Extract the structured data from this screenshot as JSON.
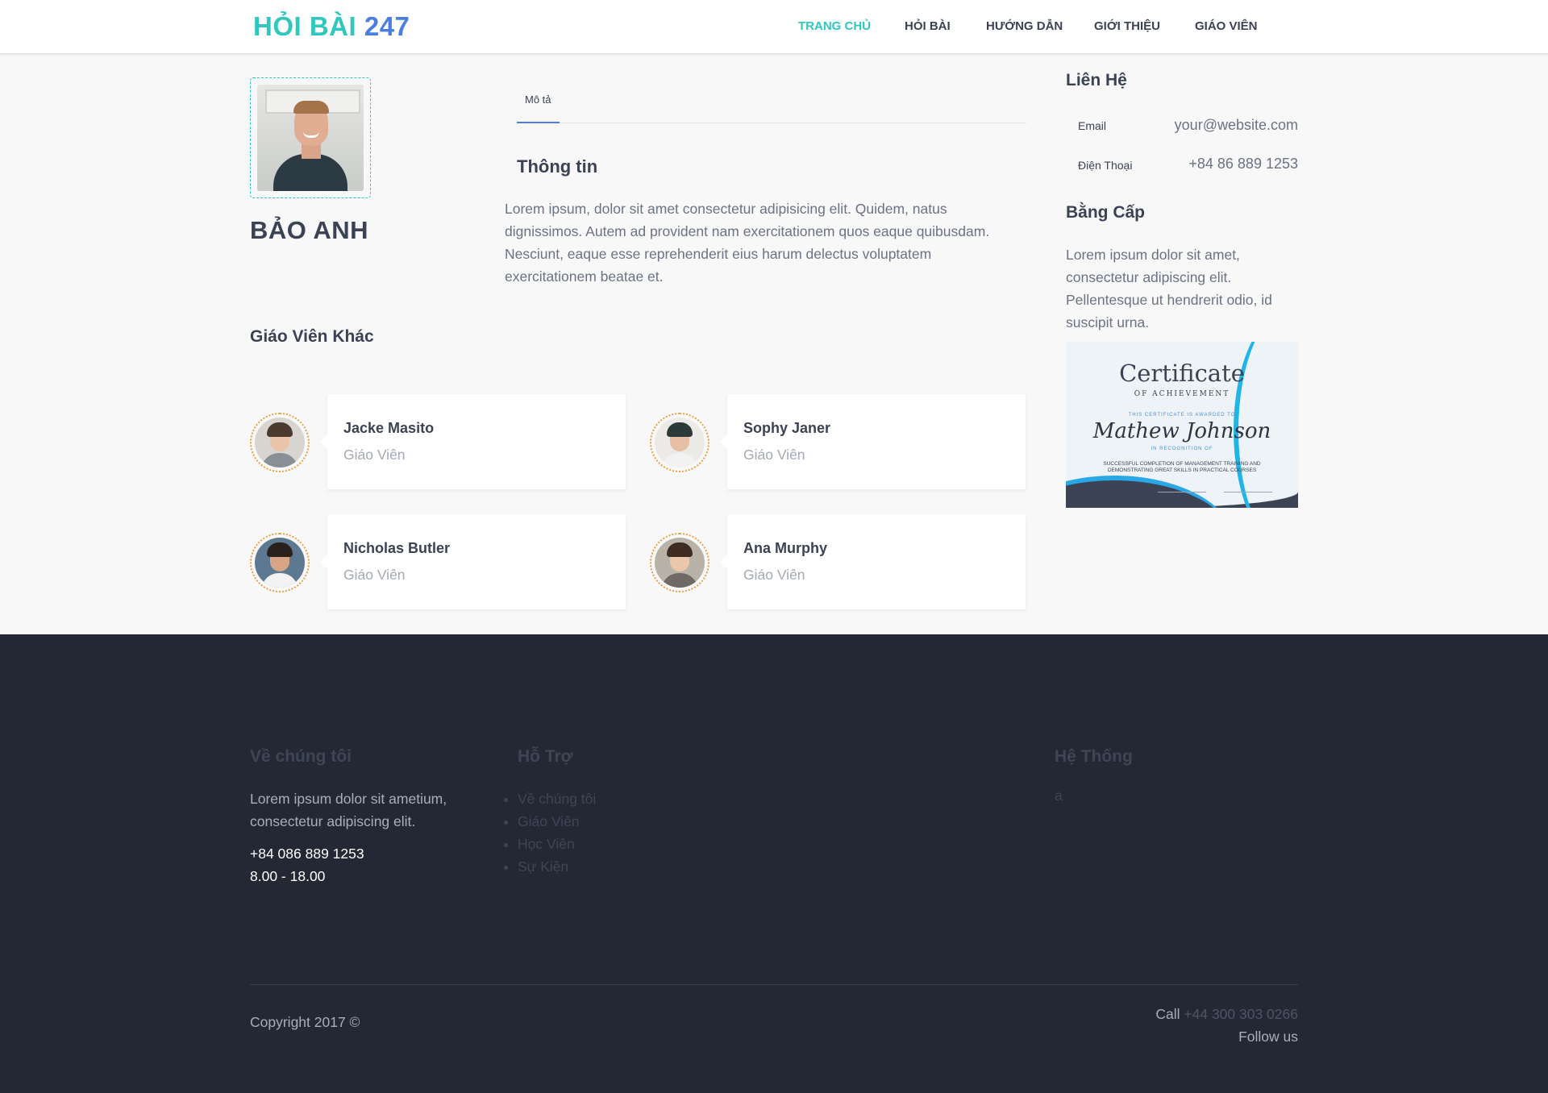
{
  "header": {
    "logo_part1": "HỎI BÀI",
    "logo_part2": "247",
    "nav": [
      {
        "label": "TRANG CHỦ",
        "active": true
      },
      {
        "label": "HỎI BÀI",
        "active": false
      },
      {
        "label": "HƯỚNG DẪN",
        "active": false
      },
      {
        "label": "GIỚI THIỆU",
        "active": false
      },
      {
        "label": "GIÁO VIÊN",
        "active": false
      }
    ]
  },
  "profile": {
    "name": "BẢO ANH"
  },
  "tabs": {
    "description": "Mô tả"
  },
  "info": {
    "title": "Thông tin",
    "text": "Lorem ipsum, dolor sit amet consectetur adipisicing elit. Quidem, natus dignissimos. Autem ad provident nam exercitationem quos eaque quibusdam. Nesciunt, eaque esse reprehenderit eius harum delectus voluptatem exercitationem beatae et."
  },
  "others": {
    "title": "Giáo Viên Khác",
    "teachers": [
      {
        "name": "Jacke Masito",
        "role": "Giáo Viên"
      },
      {
        "name": "Sophy Janer",
        "role": "Giáo Viên"
      },
      {
        "name": "Nicholas Butler",
        "role": "Giáo Viên"
      },
      {
        "name": "Ana Murphy",
        "role": "Giáo Viên"
      }
    ]
  },
  "sidebar": {
    "contact_title": "Liên Hệ",
    "email_label": "Email",
    "email_value": "your@website.com",
    "phone_label": "Điện Thoại",
    "phone_value": "+84 86 889 1253",
    "degree_title": "Bằng Cấp",
    "degree_text": "Lorem ipsum dolor sit amet, consectetur adipiscing elit. Pellentesque ut hendrerit odio, id suscipit urna.",
    "certificate": {
      "title": "Certificate",
      "subtitle": "OF ACHIEVEMENT",
      "awarded": "THIS CERTIFICATE IS AWARDED TO",
      "recipient": "Mathew Johnson",
      "recognition": "IN RECOGNITION OF",
      "description": "SUCCESSFUL COMPLETION OF MANAGEMENT TRAINING AND DEMONSTRATING GREAT SKILLS IN PRACTICAL COURSES"
    }
  },
  "footer": {
    "about_title": "Về chúng tôi",
    "about_text": "Lorem ipsum dolor sit ametium, consectetur adipiscing elit.",
    "about_phone": "+84 086 889 1253",
    "about_hours": "8.00 - 18.00",
    "support_title": "Hỗ Trợ",
    "support_items": [
      "Về chúng tôi",
      "Giáo Viên",
      "Học Viên",
      "Sự Kiện"
    ],
    "system_title": "Hệ Thống",
    "system_text": "a",
    "copyright": "Copyright 2017 ©",
    "call_label": "Call",
    "call_number": "+44 300 303 0266",
    "follow": "Follow us"
  },
  "colors": {
    "accent_teal": "#2fc7be",
    "accent_blue": "#4a7fe0",
    "footer_bg": "#232834",
    "avatar_border": "#e8a043"
  }
}
